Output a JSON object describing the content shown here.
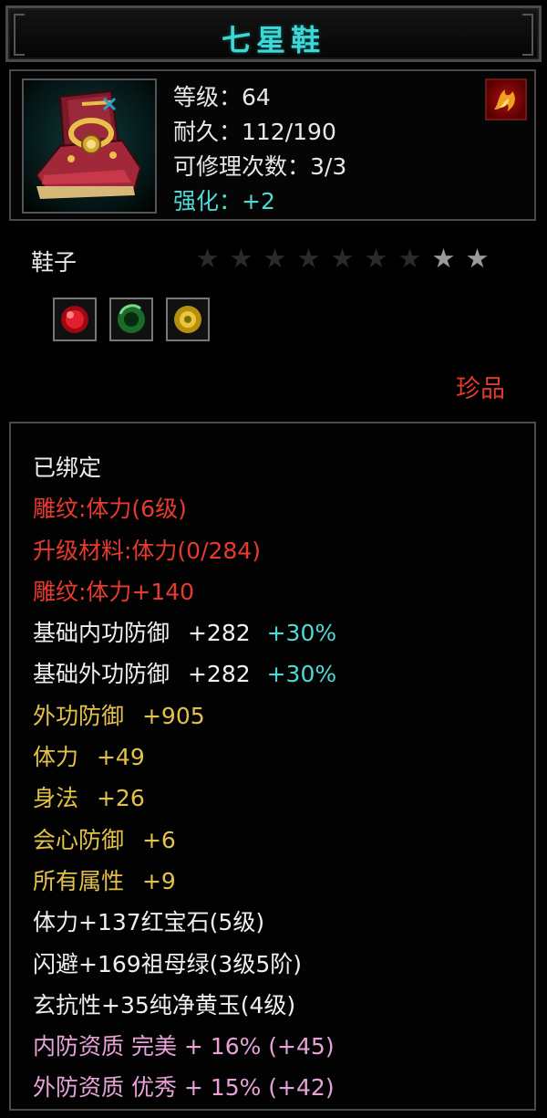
{
  "title": "七星鞋",
  "item": {
    "icon": "boots-icon",
    "stats": [
      {
        "text": "等级：64",
        "color": "#e8e8e8"
      },
      {
        "text": "耐久：112/190",
        "color": "#e8e8e8"
      },
      {
        "text": "可修理次数：3/3",
        "color": "#e8e8e8"
      },
      {
        "text": "强化：+2",
        "color": "#4fd8d8"
      }
    ],
    "type": "鞋子",
    "stars": {
      "total": 9,
      "filled": 2
    },
    "gems": [
      "ruby-gem-icon",
      "emerald-gem-icon",
      "topaz-gem-icon"
    ],
    "rarity": "珍品"
  },
  "attributes": {
    "bound": "已绑定",
    "carve": "雕纹:体力(6级)",
    "upgrade_material": "升级材料:体力(0/284)",
    "carve_bonus": "雕纹:体力+140",
    "base_inner_def": {
      "label": "基础内功防御",
      "value": "+282",
      "pct": "+30%"
    },
    "base_outer_def": {
      "label": "基础外功防御",
      "value": "+282",
      "pct": "+30%"
    },
    "outer_def": {
      "label": "外功防御",
      "value": "+905"
    },
    "stamina": {
      "label": "体力",
      "value": "+49"
    },
    "agility": {
      "label": "身法",
      "value": "+26"
    },
    "crit_def": {
      "label": "会心防御",
      "value": "+6"
    },
    "all_attr": {
      "label": "所有属性",
      "value": "+9"
    },
    "gem1": "体力+137红宝石(5级)",
    "gem2": "闪避+169祖母绿(3级5阶)",
    "gem3": "玄抗性+35纯净黄玉(4级)",
    "quality_inner": "内防资质 完美 + 16% (+45)",
    "quality_outer": "外防资质 优秀 + 15% (+42)"
  },
  "colors": {
    "title": "#3fd6d6",
    "red": "#e83a2e",
    "gold": "#e4c24a",
    "pink": "#e8a2d8",
    "cyan": "#4fd8d8"
  }
}
